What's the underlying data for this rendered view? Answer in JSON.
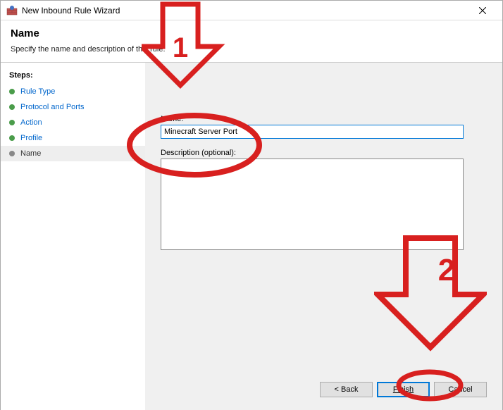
{
  "window": {
    "title": "New Inbound Rule Wizard"
  },
  "header": {
    "heading": "Name",
    "description": "Specify the name and description of this rule."
  },
  "sidebar": {
    "title": "Steps:",
    "items": [
      {
        "label": "Rule Type"
      },
      {
        "label": "Protocol and Ports"
      },
      {
        "label": "Action"
      },
      {
        "label": "Profile"
      },
      {
        "label": "Name"
      }
    ]
  },
  "main": {
    "name_label": "Name:",
    "name_value": "Minecraft Server Port",
    "desc_label": "Description (optional):",
    "desc_value": ""
  },
  "buttons": {
    "back": "< Back",
    "finish": "Finish",
    "cancel": "Cancel"
  },
  "annotations": {
    "num1": "1",
    "num2": "2"
  }
}
